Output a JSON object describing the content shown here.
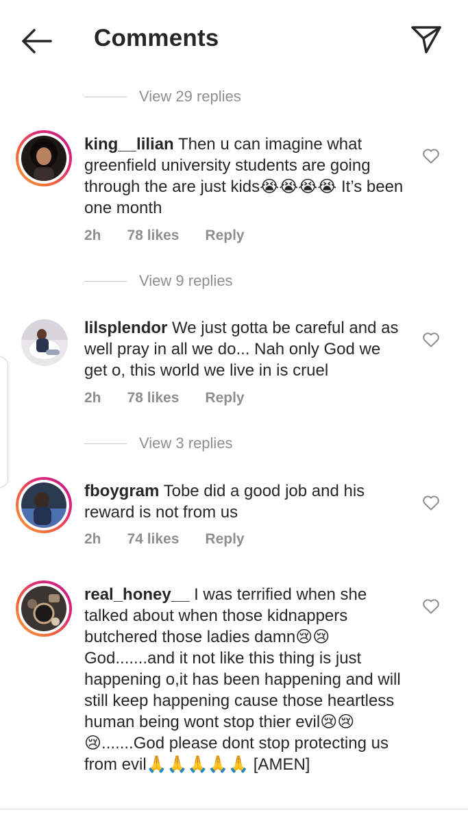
{
  "header": {
    "title": "Comments",
    "back_icon": "arrow-left-icon",
    "send_icon": "paper-plane-icon"
  },
  "view_replies": [
    {
      "label": "View 29 replies"
    },
    {
      "label": "View 9 replies"
    },
    {
      "label": "View 3 replies"
    }
  ],
  "comments": [
    {
      "username": "king__lilian",
      "text": "Then u can imagine what greenfield university students are going through the are just kids😭😭😭😭 It’s been one month",
      "time": "2h",
      "likes": "78 likes",
      "reply": "Reply",
      "avatar_ring": true
    },
    {
      "username": "lilsplendor",
      "text": "We just gotta be careful and as well pray in all we do... Nah only God we get o,  this world we live in is cruel",
      "time": "2h",
      "likes": "78 likes",
      "reply": "Reply",
      "avatar_ring": false
    },
    {
      "username": "fboygram",
      "text": "Tobe did a good job and his reward is not from us",
      "time": "2h",
      "likes": "74 likes",
      "reply": "Reply",
      "avatar_ring": true
    },
    {
      "username": "real_honey__",
      "text": "I was terrified when she talked about when those kidnappers butchered those ladies damn😢😢 God.......and it not like this thing is just happening o,it has been happening and will still keep happening cause those heartless human being wont stop thier evil😢😢😢.......God please dont stop protecting us from evil🙏🙏🙏🙏🙏 [AMEN]",
      "avatar_ring": true
    }
  ],
  "colors": {
    "text": "#262626",
    "muted": "#8e8e8e",
    "ring_start": "#f9a13b",
    "ring_end": "#c2188c"
  }
}
